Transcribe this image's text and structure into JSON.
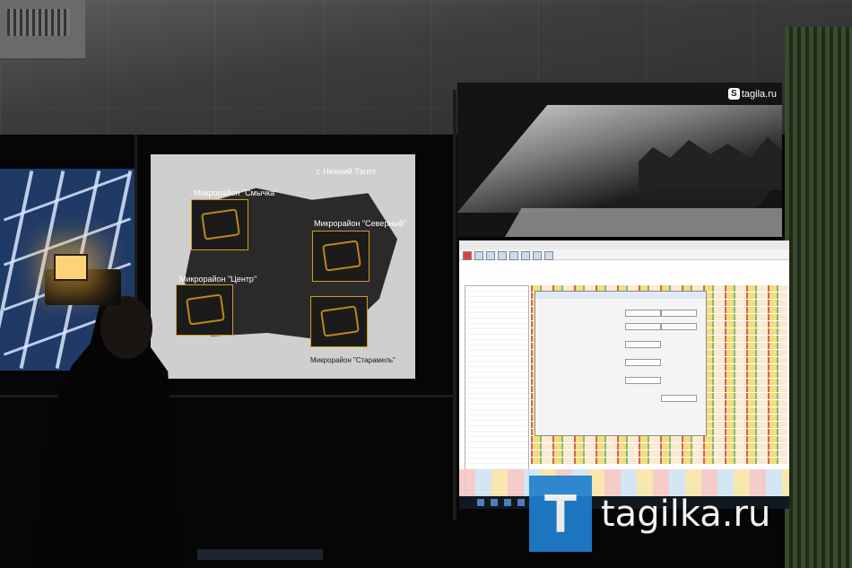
{
  "scene": {
    "description_free": true
  },
  "slide": {
    "city_title": "г. Нижний Тагил",
    "labels": {
      "smychka": "Микрорайон \"Смычка\"",
      "severny": "Микрорайон \"Северный\"",
      "tsentr": "Микрорайон \"Центр\"",
      "staramel": "Микрорайон \"Старамель\""
    }
  },
  "camera_feed": {
    "watermark": "tagila.ru",
    "watermark_badge": "S"
  },
  "brand": {
    "logo_letter": "T",
    "site": "tagilka.ru",
    "logo_color": "#1f7fcf"
  }
}
